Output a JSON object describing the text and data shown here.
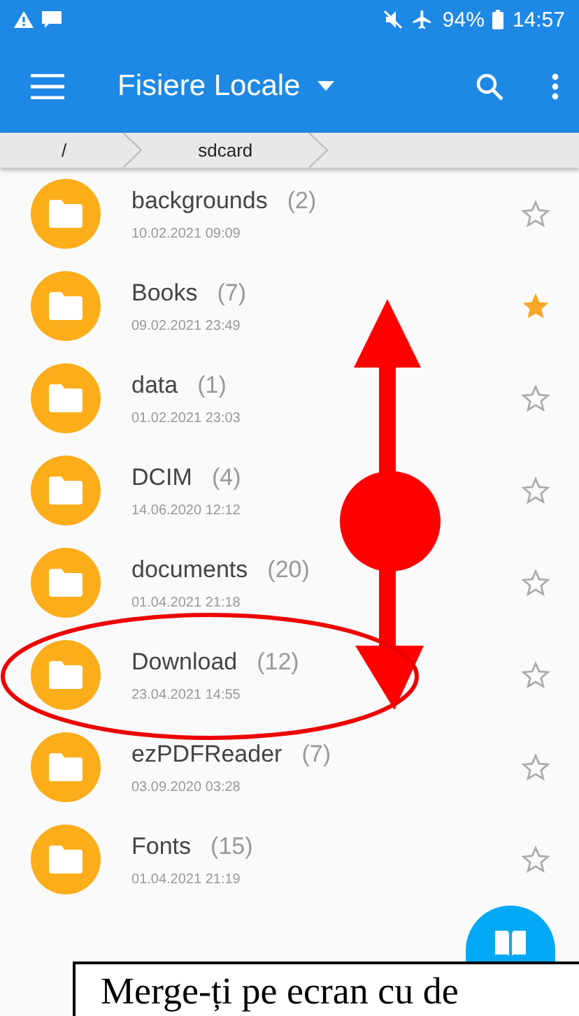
{
  "status_bar": {
    "battery": "94%",
    "time": "14:57"
  },
  "app_bar": {
    "title": "Fisiere Locale"
  },
  "breadcrumb": [
    {
      "label": "/"
    },
    {
      "label": "sdcard"
    }
  ],
  "folders": [
    {
      "name": "backgrounds",
      "count": "(2)",
      "date": "10.02.2021 09:09",
      "starred": false
    },
    {
      "name": "Books",
      "count": "(7)",
      "date": "09.02.2021 23:49",
      "starred": true
    },
    {
      "name": "data",
      "count": "(1)",
      "date": "01.02.2021 23:03",
      "starred": false
    },
    {
      "name": "DCIM",
      "count": "(4)",
      "date": "14.06.2020 12:12",
      "starred": false
    },
    {
      "name": "documents",
      "count": "(20)",
      "date": "01.04.2021 21:18",
      "starred": false
    },
    {
      "name": "Download",
      "count": "(12)",
      "date": "23.04.2021 14:55",
      "starred": false
    },
    {
      "name": "ezPDFReader",
      "count": "(7)",
      "date": "03.09.2020 03:28",
      "starred": false
    },
    {
      "name": "Fonts",
      "count": "(15)",
      "date": "01.04.2021 21:19",
      "starred": false
    }
  ],
  "caption": "Merge-ți pe ecran cu de"
}
